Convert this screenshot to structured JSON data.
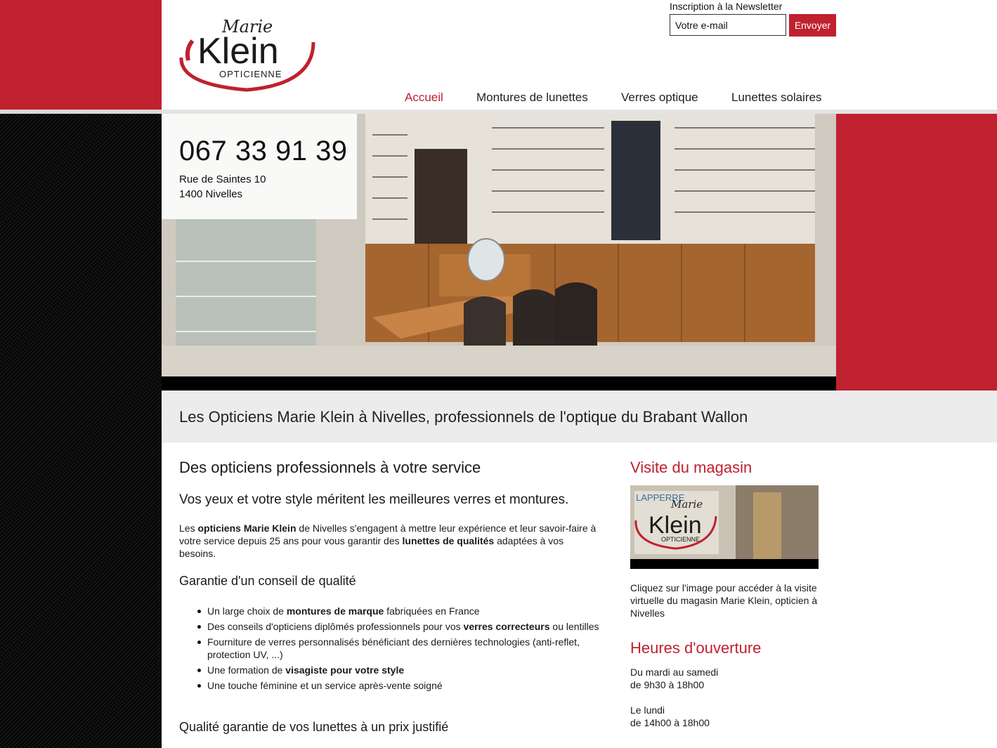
{
  "brand": {
    "logo_line1": "Marie",
    "logo_line2": "Klein",
    "logo_line3": "OPTICIENNE",
    "color_red": "#c0212f"
  },
  "newsletter": {
    "label": "Inscription à la Newsletter",
    "placeholder": "Votre e-mail",
    "button": "Envoyer"
  },
  "nav": {
    "items": [
      {
        "label": "Accueil",
        "active": true
      },
      {
        "label": "Montures de lunettes",
        "active": false
      },
      {
        "label": "Verres optique",
        "active": false
      },
      {
        "label": "Lunettes solaires",
        "active": false
      }
    ]
  },
  "hero": {
    "image": "shop-interior-photo",
    "phone": "067 33 91 39",
    "address_line1": "Rue de Saintes 10",
    "address_line2": "1400 Nivelles"
  },
  "tagline": "Les Opticiens Marie Klein à Nivelles, professionnels de l'optique du Brabant Wallon",
  "main": {
    "heading": "Des opticiens professionnels à votre service",
    "subheading": "Vos yeux et votre style méritent les meilleures verres et montures.",
    "paragraph": {
      "p1": "Les ",
      "b1": "opticiens Marie Klein",
      "p2": " de Nivelles s'engagent à mettre leur expérience et leur savoir-faire à votre service depuis 25 ans pour vous garantir des ",
      "b2": "lunettes de qualités",
      "p3": " adaptées à vos besoins."
    },
    "section1_title": "Garantie d'un conseil de qualité",
    "bullets": [
      {
        "pre": "Un large choix de ",
        "bold": "montures de marque",
        "post": " fabriquées en France"
      },
      {
        "pre": "Des conseils d'opticiens diplômés professionnels pour vos ",
        "bold": "verres correcteurs",
        "post": " ou lentilles"
      },
      {
        "pre": "Fourniture de verres personnalisés bénéficiant des dernières technologies (anti-reflet, protection UV, ...)",
        "bold": "",
        "post": ""
      },
      {
        "pre": "Une formation de ",
        "bold": "visagiste pour votre style",
        "post": ""
      },
      {
        "pre": "Une touche féminine et un service après-vente soigné",
        "bold": "",
        "post": ""
      }
    ],
    "section2_title": "Qualité garantie de vos lunettes à un prix justifié"
  },
  "sidebar": {
    "visit_title": "Visite du magasin",
    "visit_image_text": "Klein",
    "visit_image_small": "Marie",
    "visit_image_sub": "OPTICIENNE",
    "visit_image_store": "LAPPERRE",
    "visit_caption": "Cliquez sur l'image pour accéder à la visite virtuelle du magasin Marie Klein, opticien à Nivelles",
    "hours_title": "Heures d'ouverture",
    "hours1_days": "Du mardi au samedi",
    "hours1_time": "de 9h30 à 18h00",
    "hours2_days": "Le lundi",
    "hours2_time": "de 14h00 à 18h00"
  }
}
